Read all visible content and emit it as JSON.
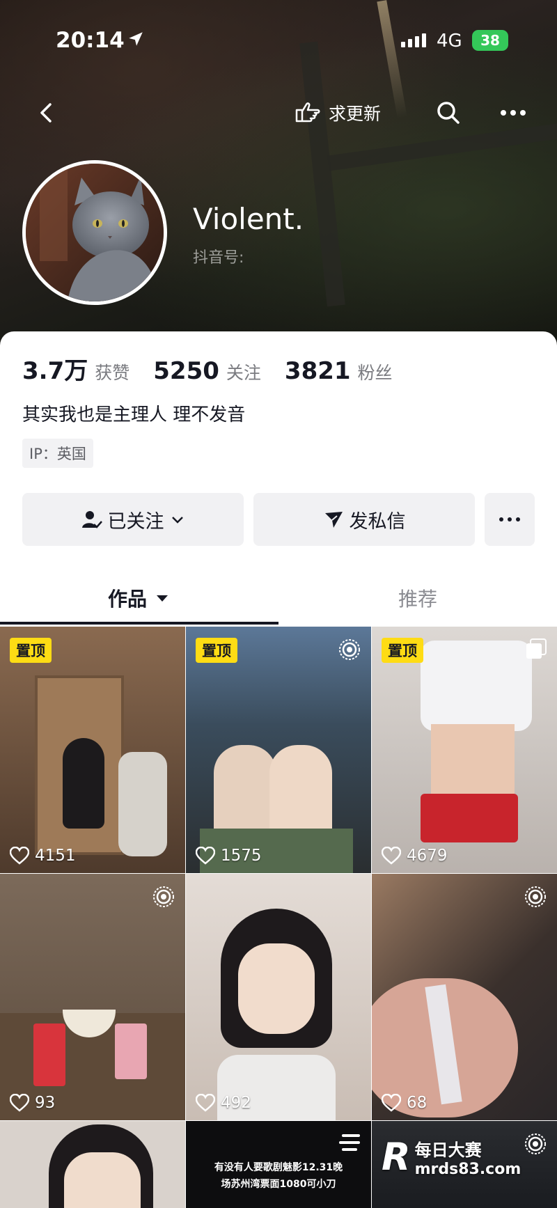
{
  "status_bar": {
    "time": "20:14",
    "network": "4G",
    "battery": "38"
  },
  "nav": {
    "request_update_label": "求更新"
  },
  "profile": {
    "username": "Violent.",
    "douyin_id_label": "抖音号:",
    "stats": [
      {
        "value": "3.7万",
        "label": "获赞"
      },
      {
        "value": "5250",
        "label": "关注"
      },
      {
        "value": "3821",
        "label": "粉丝"
      }
    ],
    "bio": "其实我也是主理人 理不发音",
    "ip": "IP：英国"
  },
  "actions": {
    "follow_label": "已关注",
    "message_label": "发私信"
  },
  "tabs": [
    {
      "label": "作品"
    },
    {
      "label": "推荐"
    }
  ],
  "videos": [
    {
      "likes": "4151",
      "pinned": "置顶",
      "corner_icon": "none"
    },
    {
      "likes": "1575",
      "pinned": "置顶",
      "corner_icon": "live-photo-icon"
    },
    {
      "likes": "4679",
      "pinned": "置顶",
      "corner_icon": "image-set-icon"
    },
    {
      "likes": "93",
      "corner_icon": "live-photo-icon"
    },
    {
      "likes": "492",
      "corner_icon": "none"
    },
    {
      "likes": "68",
      "corner_icon": "live-photo-icon"
    },
    {
      "corner_icon": "none"
    },
    {
      "overlay_text_line1": "有没有人要歌剧魅影12.31晚",
      "overlay_text_line2": "场苏州湾票面1080可小刀",
      "corner_icon": "list-icon"
    },
    {
      "corner_icon": "live-photo-icon"
    }
  ],
  "watermark": {
    "logo": "R",
    "name": "每日大赛",
    "url": "mrds83.com"
  },
  "colors": {
    "pin_badge": "#fedc14",
    "battery": "#34c759",
    "text_primary": "#161823"
  }
}
